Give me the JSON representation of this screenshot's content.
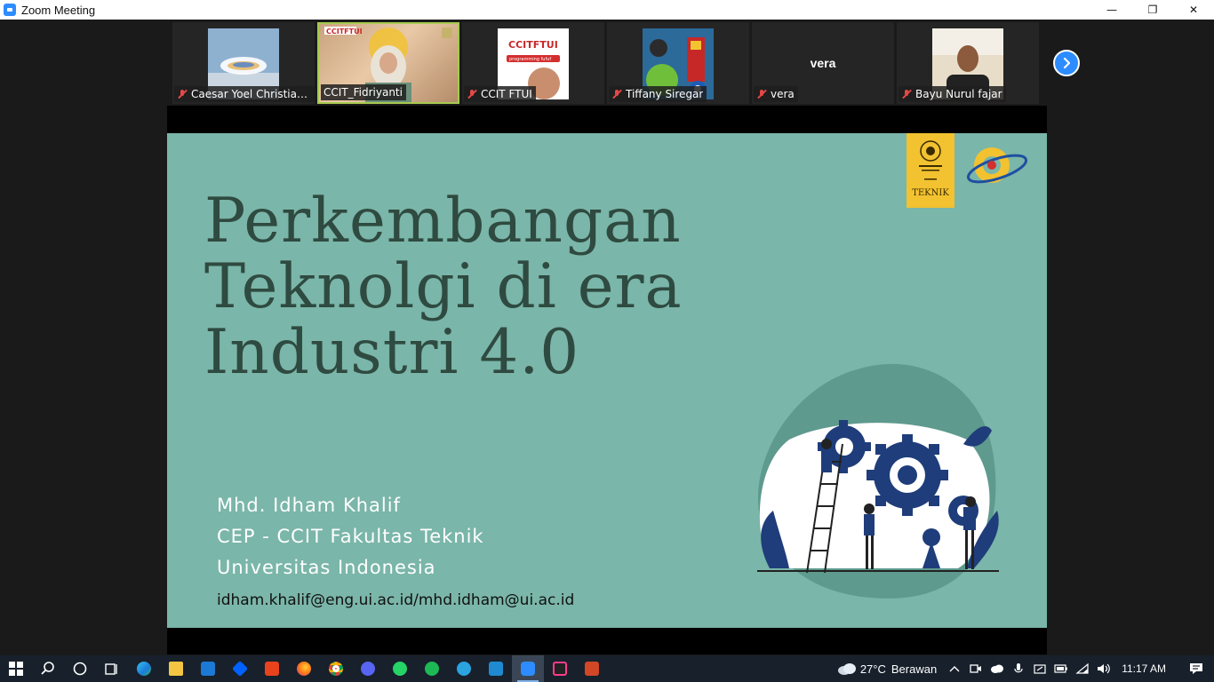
{
  "window": {
    "title": "Zoom Meeting",
    "minimize": "—",
    "restore": "❐",
    "close": "✕"
  },
  "gallery": {
    "participants": [
      {
        "name": "Caesar Yoel Christian ...",
        "muted": true
      },
      {
        "name": "CCIT_Fidriyanti",
        "muted": false,
        "active_speaker": true
      },
      {
        "name": "CCIT FTUI",
        "muted": true
      },
      {
        "name": "Tiffany Siregar",
        "muted": true
      },
      {
        "name": "vera",
        "muted": true,
        "video_off_label": "vera"
      },
      {
        "name": "Bayu Nurul fajar",
        "muted": true
      }
    ],
    "next_page_icon": "chevron-right-icon"
  },
  "slide": {
    "title_lines": [
      "Perkembangan",
      "Teknolgi di era",
      "Industri 4.0"
    ],
    "presenter_lines": [
      "Mhd. Idham Khalif",
      "CEP - CCIT Fakultas Teknik",
      "Universitas Indonesia"
    ],
    "email": "idham.khalif@eng.ui.ac.id/mhd.idham@ui.ac.id",
    "badge_text": "TEKNIK",
    "background_color": "#7ab6a9",
    "title_color": "#2f4a40"
  },
  "taskbar": {
    "apps": [
      "windows-start",
      "search",
      "task-view",
      "widgets",
      "edge",
      "file-explorer",
      "mail",
      "dropbox",
      "office",
      "firefox",
      "chrome",
      "discord",
      "whatsapp",
      "spotify",
      "telegram",
      "vscode",
      "zoom",
      "app-pink",
      "powerpoint"
    ],
    "weather_temp": "27°C",
    "weather_desc": "Berawan",
    "clock": "11:17 AM"
  }
}
